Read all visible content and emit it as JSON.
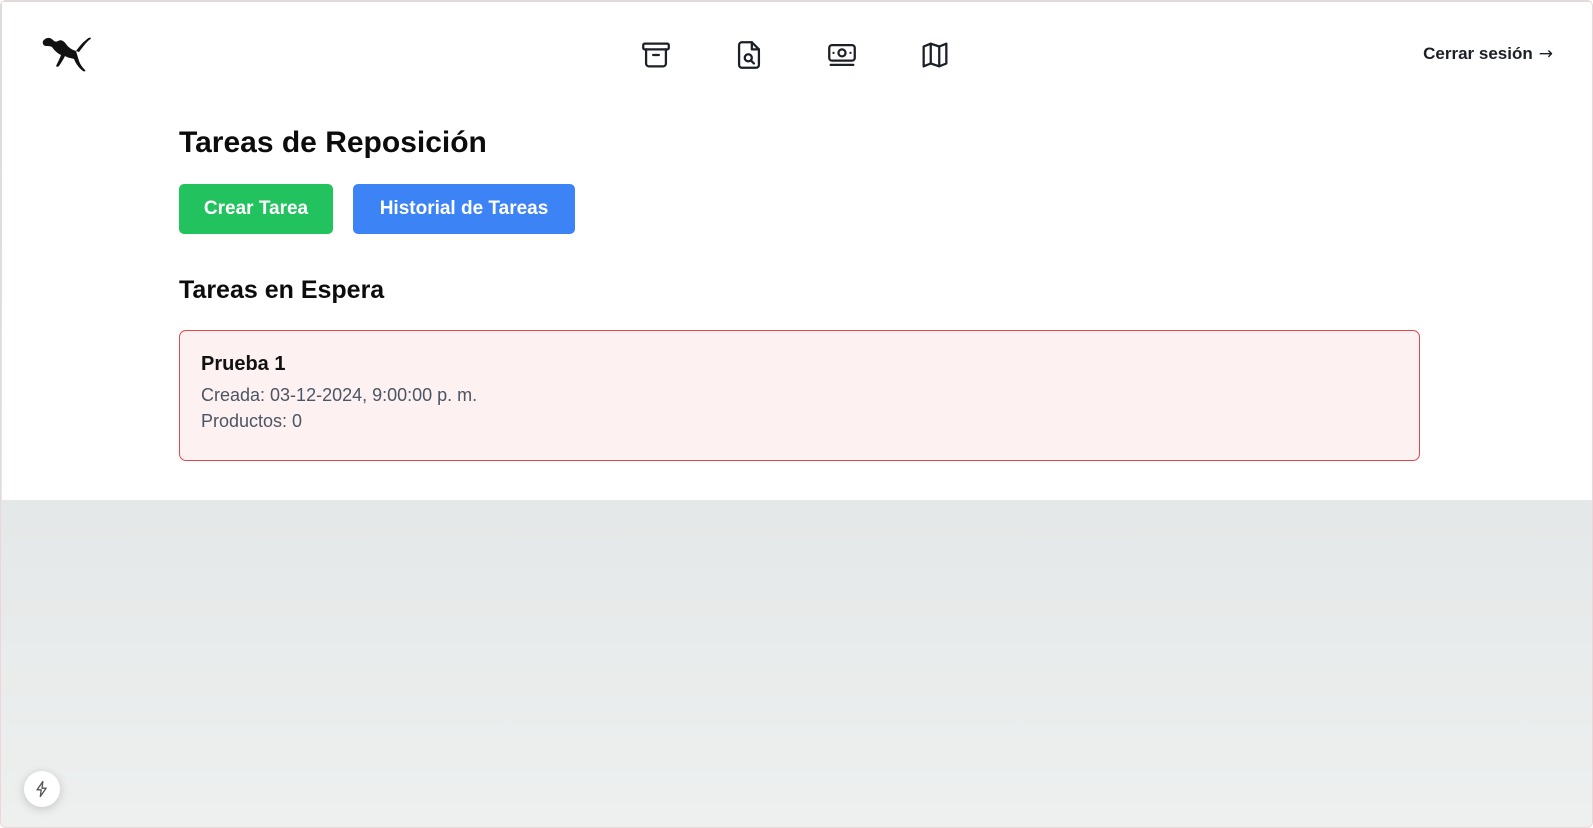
{
  "nav": {
    "logo": "puma-logo",
    "icons": [
      "archive-icon",
      "document-search-icon",
      "cash-icon",
      "map-icon"
    ],
    "logout_label": "Cerrar sesión",
    "logout_arrow": "→"
  },
  "main": {
    "title": "Tareas de Reposición",
    "create_button": "Crear Tarea",
    "history_button": "Historial de Tareas",
    "section_title": "Tareas en Espera",
    "tasks": [
      {
        "name": "Prueba 1",
        "created": "Creada: 03-12-2024, 9:00:00 p. m.",
        "products": "Productos: 0"
      }
    ]
  },
  "colors": {
    "create_button": "#22c35e",
    "history_button": "#3c83f6",
    "card_border": "#e2474d",
    "card_background": "#fdf1f1"
  },
  "badge_icon": "lightning-icon"
}
